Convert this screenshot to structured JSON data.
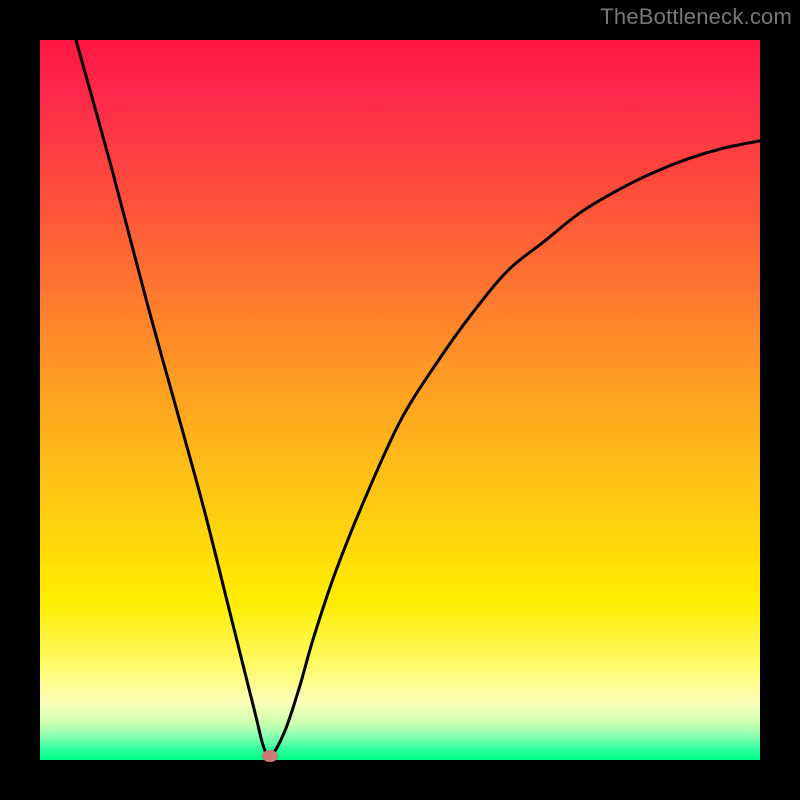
{
  "watermark": "TheBottleneck.com",
  "chart_data": {
    "type": "line",
    "title": "",
    "xlabel": "",
    "ylabel": "",
    "xlim": [
      0,
      100
    ],
    "ylim": [
      0,
      100
    ],
    "grid": false,
    "legend": false,
    "series": [
      {
        "name": "bottleneck-curve",
        "x": [
          5,
          10,
          15,
          20,
          23,
          26,
          28,
          30,
          31,
          32,
          34,
          36,
          38,
          41,
          45,
          50,
          55,
          60,
          65,
          70,
          75,
          80,
          85,
          90,
          95,
          100
        ],
        "y": [
          100,
          82,
          63,
          45,
          34,
          22,
          14,
          6,
          2,
          0.5,
          4,
          10,
          17,
          26,
          36,
          47,
          55,
          62,
          68,
          72,
          76,
          79,
          81.5,
          83.5,
          85,
          86
        ]
      }
    ],
    "annotations": [
      {
        "name": "optimal-point",
        "x": 32,
        "y": 0.5
      }
    ],
    "background_gradient": {
      "top": "#ff1744",
      "upper_mid": "#ff9326",
      "lower_mid": "#ffee00",
      "bottom": "#00ff88"
    }
  }
}
